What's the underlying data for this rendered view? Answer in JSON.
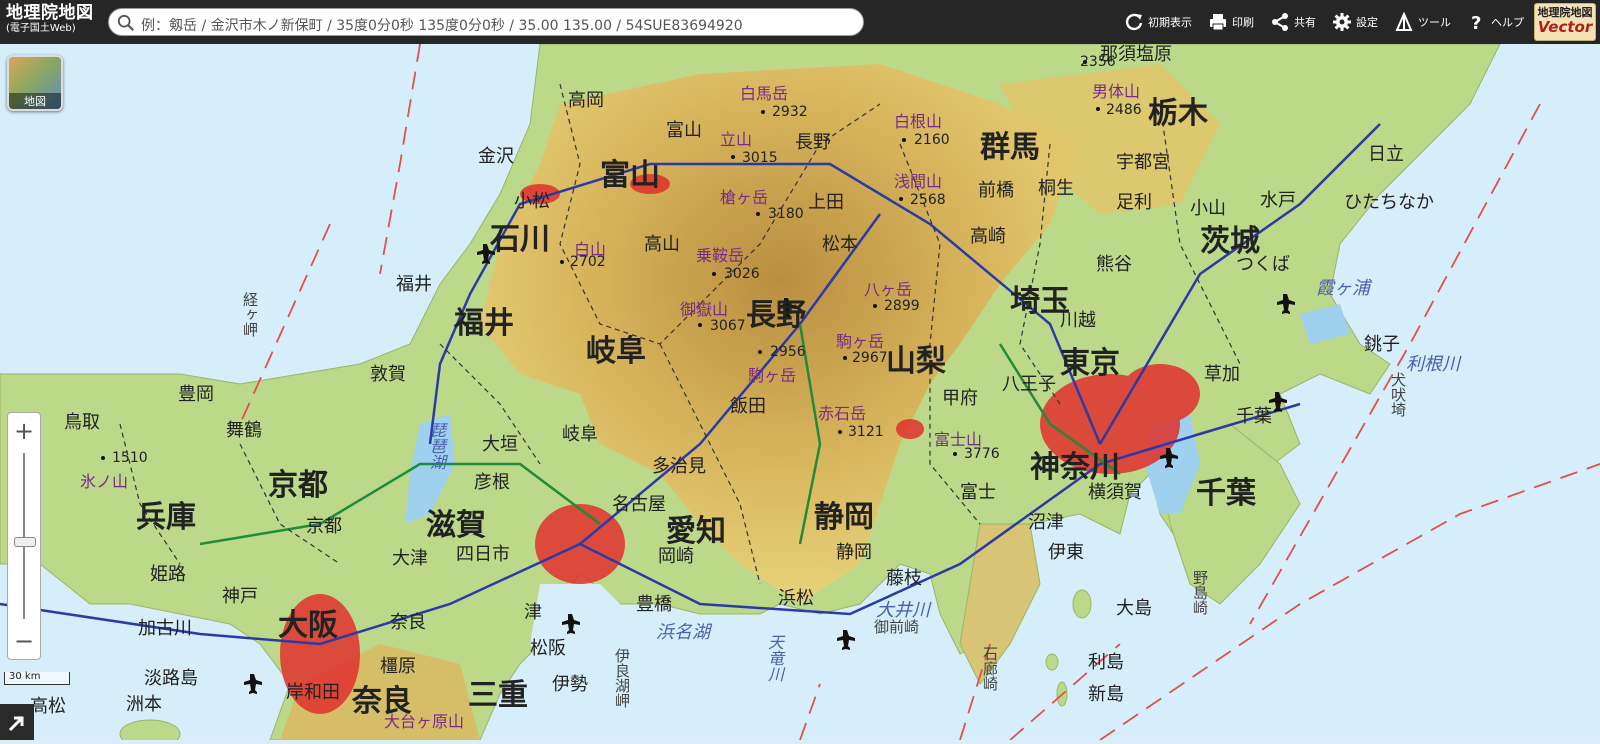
{
  "header": {
    "brand_main": "地理院地図",
    "brand_sub": "(電子国土Web)",
    "search_placeholder": "例：剱岳 / 金沢市木ノ新保町 / 35度0分0秒 135度0分0秒 / 35.00 135.00 / 54SUE83694920",
    "tools": [
      {
        "label": "初期表示",
        "icon": "refresh-icon"
      },
      {
        "label": "印刷",
        "icon": "printer-icon"
      },
      {
        "label": "共有",
        "icon": "share-icon"
      },
      {
        "label": "設定",
        "icon": "gear-icon"
      },
      {
        "label": "ツール",
        "icon": "ruler-icon"
      },
      {
        "label": "ヘルプ",
        "icon": "help-icon"
      }
    ],
    "vector_badge": {
      "line1": "地理院地図",
      "line2": "Vector"
    }
  },
  "map": {
    "layer_button_label": "地図",
    "zoom_in": "+",
    "zoom_out": "−",
    "scale_label": "30 km",
    "prefectures": [
      "栃木",
      "群馬",
      "富山",
      "石川",
      "茨城",
      "長野",
      "埼玉",
      "福井",
      "岐阜",
      "山梨",
      "東京",
      "京都",
      "兵庫",
      "滋賀",
      "愛知",
      "静岡",
      "神奈川",
      "千葉",
      "大阪",
      "奈良",
      "三重"
    ],
    "cities": [
      "那須塩原",
      "高岡",
      "富山",
      "金沢",
      "長野",
      "日立",
      "宇都宮",
      "小松",
      "前橋",
      "桐生",
      "上田",
      "足利",
      "水戸",
      "ひたちなか",
      "高崎",
      "小山",
      "松本",
      "高山",
      "つくば",
      "熊谷",
      "福井",
      "川越",
      "銚子",
      "甲府",
      "八王子",
      "飯田",
      "敦賀",
      "豊岡",
      "舞鶴",
      "鳥取",
      "大垣",
      "岐阜",
      "多治見",
      "彦根",
      "京都",
      "名古屋",
      "富士",
      "沼津",
      "横須賀",
      "千葉",
      "姫路",
      "大津",
      "四日市",
      "岡崎",
      "静岡",
      "伊東",
      "藤枝",
      "神戸",
      "浜松",
      "豊橋",
      "加古川",
      "奈良",
      "津",
      "松阪",
      "大島",
      "橿原",
      "淡路島",
      "洲本",
      "高松",
      "伊勢",
      "利島",
      "新島",
      "岸和田",
      "草加"
    ],
    "peaks": [
      "白馬岳",
      "白根山",
      "男体山",
      "立山",
      "浅間山",
      "槍ヶ岳",
      "白山",
      "乗鞍岳",
      "八ヶ岳",
      "御嶽山",
      "駒ヶ岳",
      "駒ヶ岳",
      "赤石岳",
      "富士山",
      "氷ノ山",
      "大台ヶ原山"
    ],
    "elevations": [
      "2356",
      "2932",
      "2486",
      "2160",
      "3015",
      "2568",
      "3180",
      "2702",
      "3026",
      "2899",
      "3067",
      "2956",
      "2967",
      "3121",
      "3776",
      "1510"
    ],
    "waters": [
      "霞ヶ浦",
      "利根川",
      "琵琶湖",
      "浜名湖",
      "大井川",
      "天竜川"
    ],
    "capes": [
      "経ヶ岬",
      "犬吠埼",
      "伊良湖岬",
      "野島崎",
      "石廊崎",
      "御前崎"
    ]
  }
}
